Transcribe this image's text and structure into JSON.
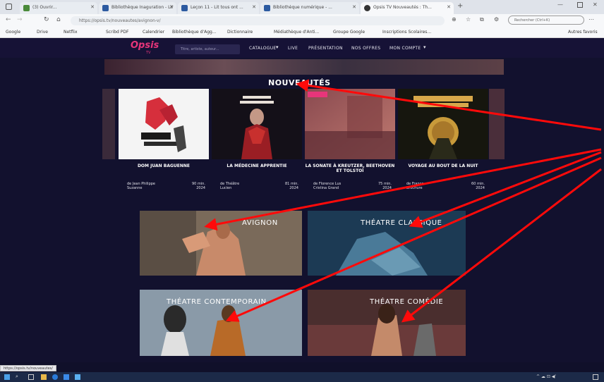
{
  "browser": {
    "tabs": [
      {
        "label": "(3) Ouvrir...",
        "active": false,
        "color": "#4a8a3a"
      },
      {
        "label": "Bibliothèque Inaguration - Lir",
        "active": false,
        "color": "#2c5aa0"
      },
      {
        "label": "Leçon 11 - Lit tous ont ...",
        "active": false,
        "color": "#2c5aa0"
      },
      {
        "label": "Bibliothèque numérique - ...",
        "active": false,
        "color": "#2c5aa0"
      },
      {
        "label": "Opsis TV Nouveautés : Th...",
        "active": true,
        "color": "#333"
      }
    ],
    "url": "https://opsis.tv/nouveautes/avignon-v/",
    "search_placeholder": "Rechercher (Ctrl+K)",
    "bookmarks": [
      "Google",
      "Drive",
      "Netflix",
      "Scribd PDF",
      "Calendrier",
      "Bibliothèque d'Agg...",
      "Dictionnaire",
      "Médiathèque d'Anti...",
      "Groupe Google",
      "Inscriptions Scolaires..."
    ],
    "bookmarks_right": "Autres favoris"
  },
  "site": {
    "logo": "Opsis",
    "logo_sub": "TV",
    "search_placeholder": "Titre, artiste, auteur...",
    "nav": [
      "CATALOGUE",
      "LIVE",
      "PRÉSENTATION",
      "NOS OFFRES",
      "MON COMPTE"
    ],
    "section_title": "NOUVEAUTÉS",
    "cards": [
      {
        "title": "DOM JUAN BAGUENNE",
        "meta_left": "de Jean Philippe\nSuzanne",
        "meta_right": "90 min.\n2024"
      },
      {
        "title": "LA MÉDECINE APPRENTIE",
        "meta_left": "de Théâtre\nLucien",
        "meta_right": "81 min.\n2024"
      },
      {
        "title": "LA SONATE À KREUTZER, BEETHOVEN ET TOLSTOÏ",
        "meta_left": "de Florence Lus\nCristina Grand",
        "meta_right": "75 min.\n2024"
      },
      {
        "title": "VOYAGE AU BOUT DE LA NUIT",
        "meta_left": "de France\nBrochure",
        "meta_right": "60 min.\n2024"
      }
    ],
    "categories": [
      "AVIGNON",
      "THÉATRE CLASSIQUE",
      "THÉATRE CONTEMPORAIN",
      "THÉATRE COMÉDIE"
    ],
    "status_url": "https://opsis.tv/nouveautes/"
  }
}
